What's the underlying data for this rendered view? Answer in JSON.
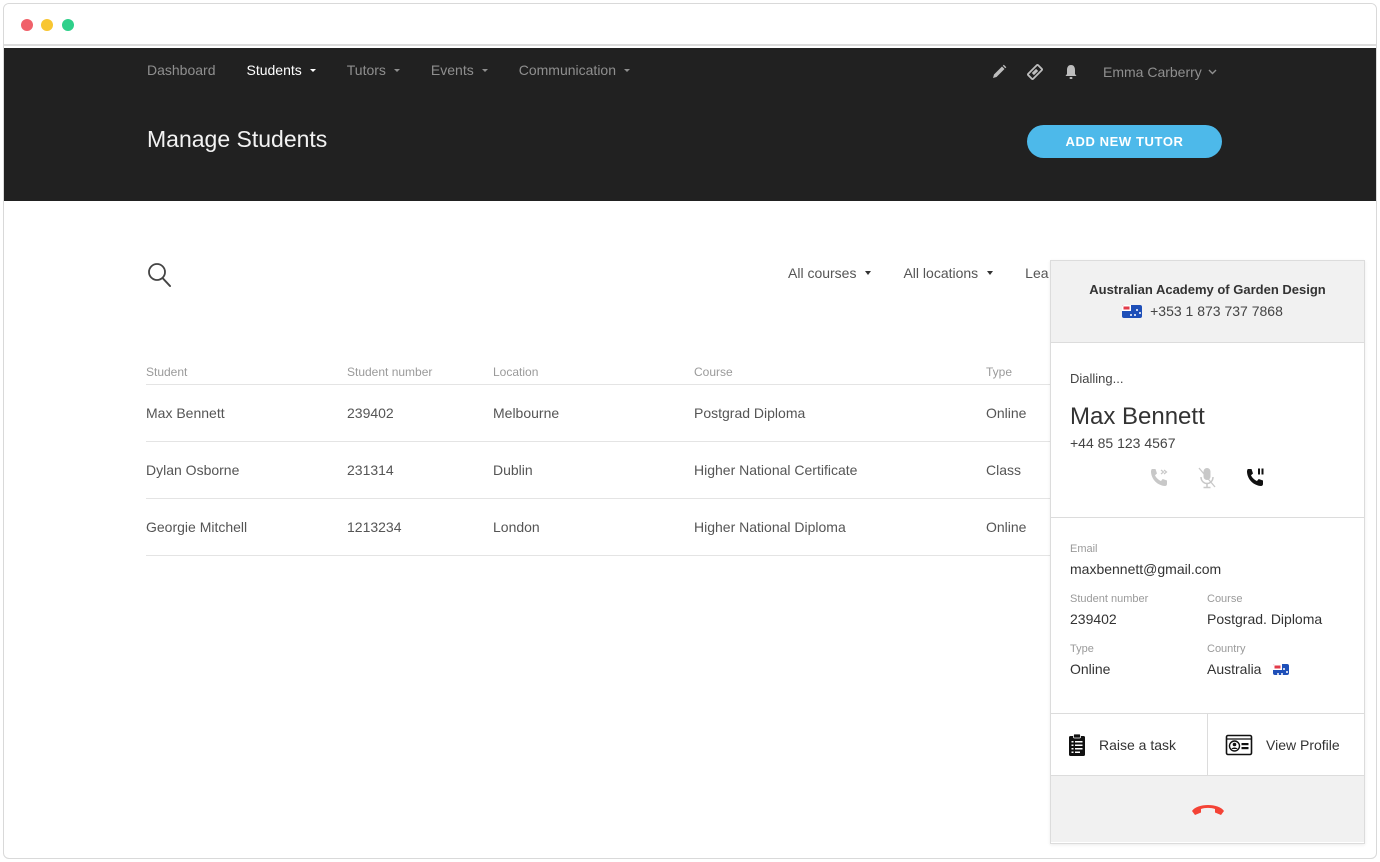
{
  "window": {
    "traffic_lights": [
      "close",
      "minimize",
      "maximize"
    ]
  },
  "nav": {
    "items": [
      {
        "label": "Dashboard",
        "active": false,
        "has_dropdown": false
      },
      {
        "label": "Students",
        "active": true,
        "has_dropdown": true
      },
      {
        "label": "Tutors",
        "active": false,
        "has_dropdown": true
      },
      {
        "label": "Events",
        "active": false,
        "has_dropdown": true
      },
      {
        "label": "Communication",
        "active": false,
        "has_dropdown": true
      }
    ],
    "icons": [
      "pencil-icon",
      "ticket-icon",
      "bell-icon"
    ],
    "user_name": "Emma Carberry"
  },
  "header": {
    "title": "Manage Students",
    "add_button_label": "ADD NEW TUTOR",
    "accent_color": "#4db9ea"
  },
  "filters": {
    "items": [
      "All courses",
      "All locations",
      "Lea"
    ]
  },
  "table": {
    "columns": [
      "Student",
      "Student number",
      "Location",
      "Course",
      "Type"
    ],
    "rows": [
      [
        "Max Bennett",
        "239402",
        "Melbourne",
        "Postgrad Diploma",
        "Online"
      ],
      [
        "Dylan Osborne",
        "231314",
        "Dublin",
        "Higher National Certificate",
        "Class"
      ],
      [
        "Georgie Mitchell",
        "1213234",
        "London",
        "Higher National Diploma",
        "Online"
      ]
    ]
  },
  "call_panel": {
    "org_name": "Australian Academy of Garden Design",
    "org_phone": "+353 1 873 737 7868",
    "status": "Dialling...",
    "contact_name": "Max Bennett",
    "contact_phone": "+44 85 123 4567",
    "controls": [
      "transfer-call-icon",
      "mute-icon",
      "hold-call-icon"
    ],
    "details": {
      "email_label": "Email",
      "email": "maxbennett@gmail.com",
      "student_number_label": "Student number",
      "student_number": "239402",
      "course_label": "Course",
      "course": "Postgrad. Diploma",
      "type_label": "Type",
      "type": "Online",
      "country_label": "Country",
      "country": "Australia"
    },
    "actions": {
      "raise_task": "Raise a task",
      "view_profile": "View Profile"
    },
    "hangup_color": "#f44336"
  }
}
